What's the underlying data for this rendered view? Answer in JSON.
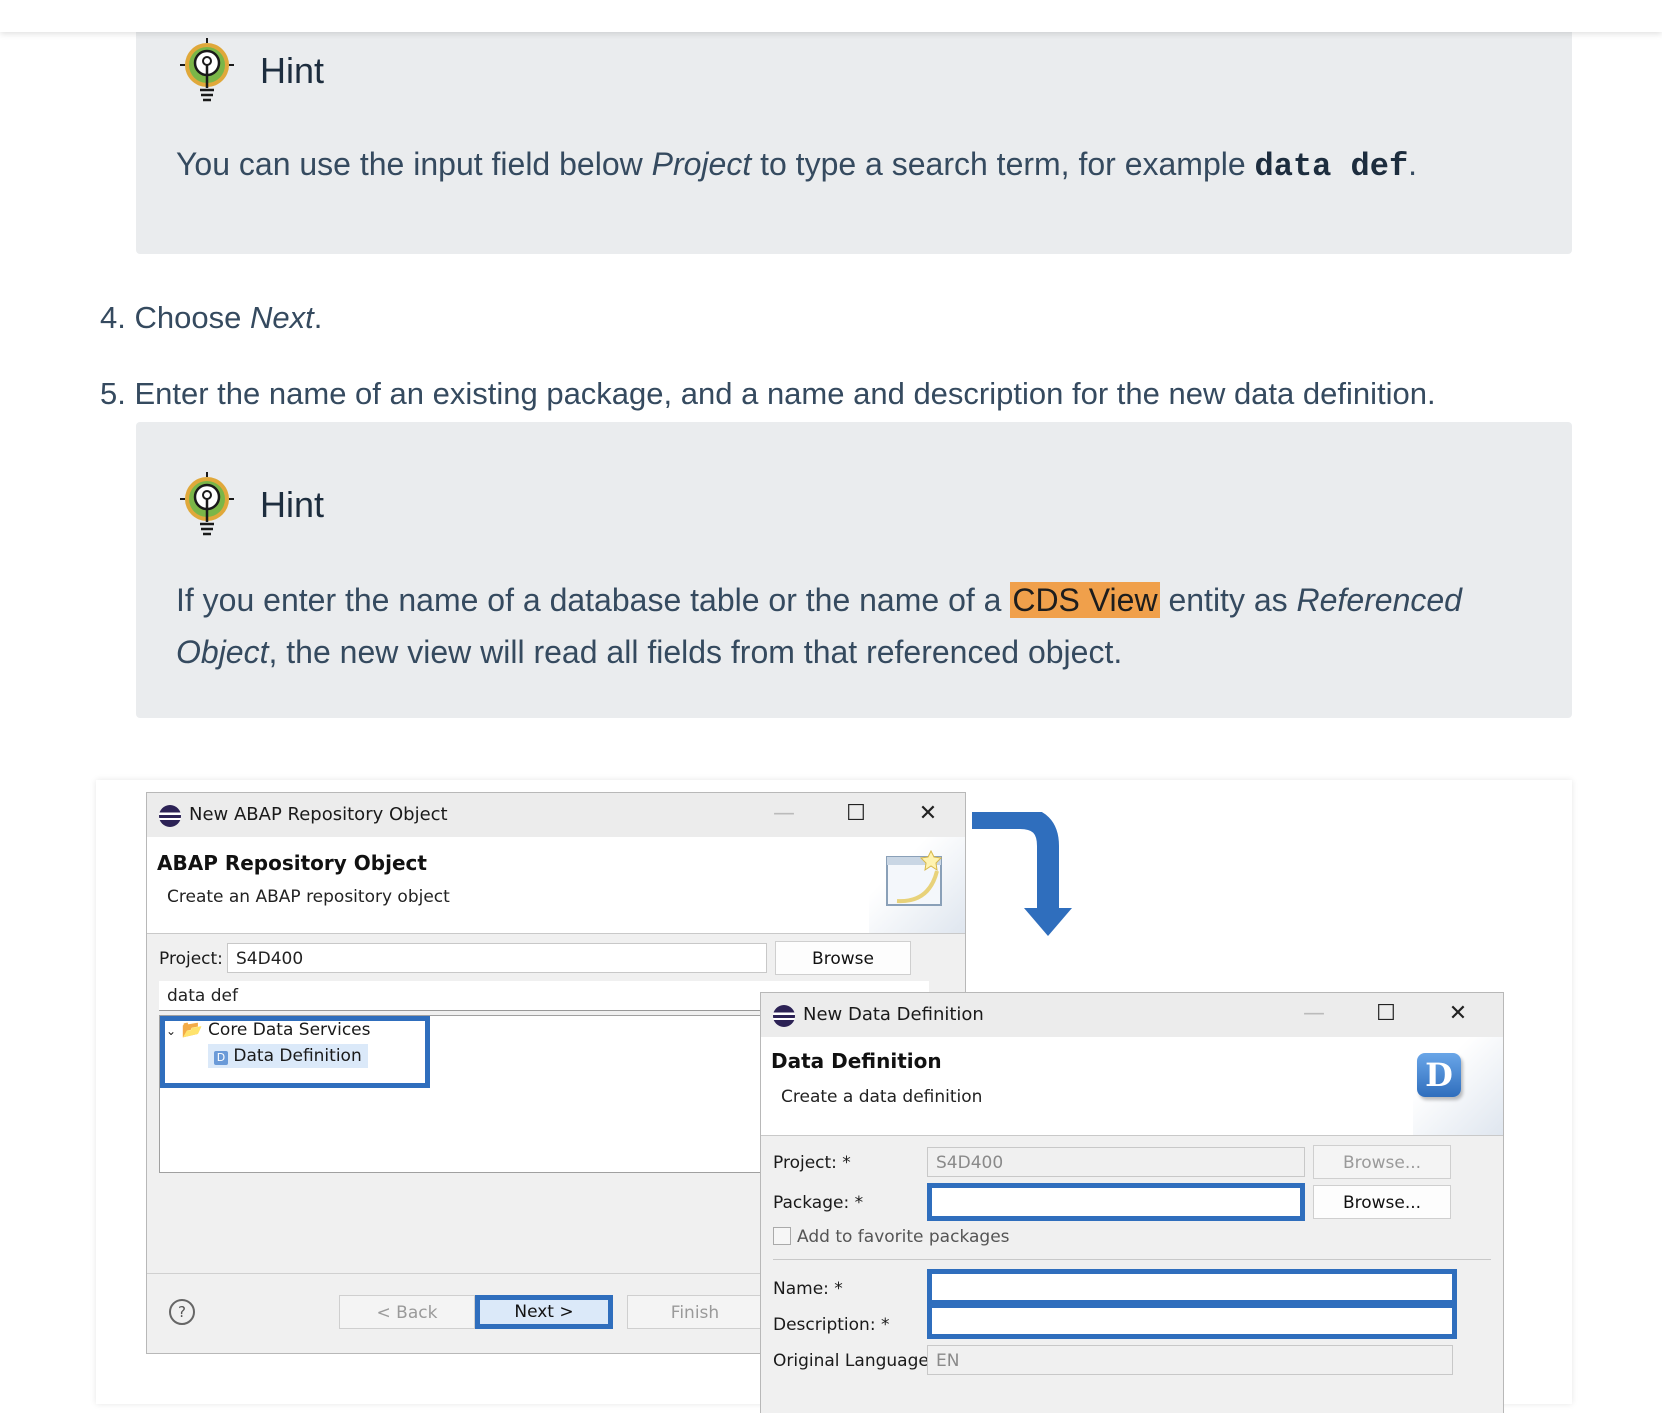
{
  "hint1": {
    "title": "Hint",
    "text_part1": "You can use the input field below ",
    "text_em": "Project",
    "text_part2": " to type a search term, for example ",
    "text_code": "data def",
    "text_part3": "."
  },
  "steps": [
    {
      "num": "4.",
      "text_part1": " Choose ",
      "text_em": "Next",
      "text_part2": "."
    },
    {
      "num": "5.",
      "text": " Enter the name of an existing package, and a name and description for the new data definition."
    }
  ],
  "hint2": {
    "title": "Hint",
    "text_part1": "If you enter the name of a database table or the name of a ",
    "text_highlight": "CDS View",
    "text_part2": " entity as ",
    "text_em1": "Referenced",
    "text_em2": "Object",
    "text_part3": ", the new view will read all fields from that referenced object."
  },
  "dialog1": {
    "window_title": "New ABAP Repository Object",
    "header_title": "ABAP Repository Object",
    "header_subtitle": "Create an ABAP repository object",
    "project_label": "Project:",
    "project_value": "S4D400",
    "browse_label": "Browse",
    "filter_value": "data def",
    "tree_folder": "Core Data Services",
    "tree_item": "Data Definition",
    "help_icon": "?",
    "back_label": "< Back",
    "next_label": "Next >",
    "finish_label": "Finish"
  },
  "dialog2": {
    "window_title": "New Data Definition",
    "header_title": "Data Definition",
    "header_subtitle": "Create a data definition",
    "logo_letter": "D",
    "project_label": "Project: *",
    "project_value": "S4D400",
    "browse1_label": "Browse...",
    "package_label": "Package: *",
    "package_value": "",
    "browse2_label": "Browse...",
    "favorite_label": "Add to favorite packages",
    "name_label": "Name: *",
    "name_value": "",
    "description_label": "Description: *",
    "description_value": "",
    "language_label": "Original Language:",
    "language_value": "EN"
  },
  "colors": {
    "highlight_box": "#2f6ebd",
    "hint_background": "#eaecee",
    "cds_highlight": "#f0a04b",
    "arrow": "#2f6ebd"
  }
}
